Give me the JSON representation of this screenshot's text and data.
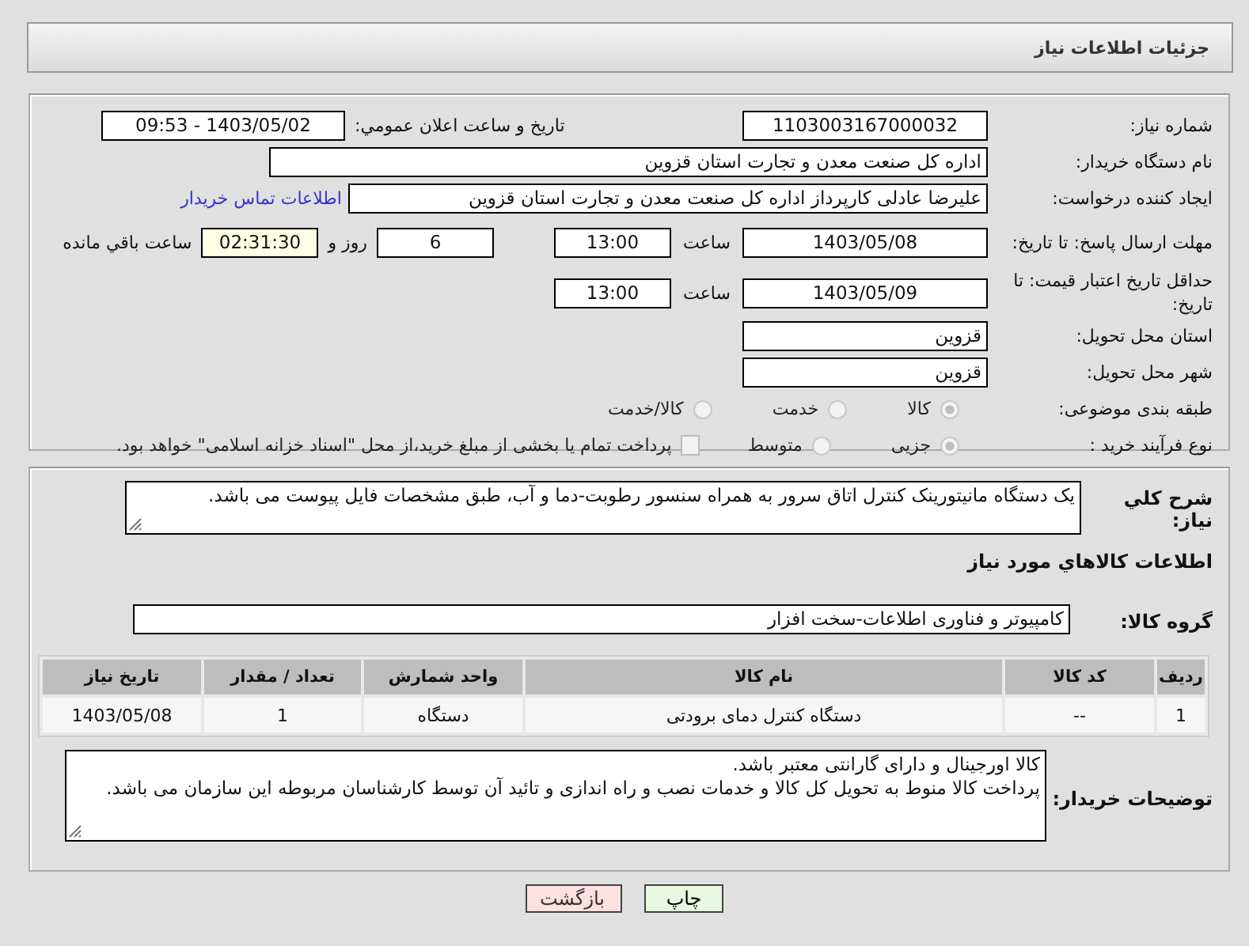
{
  "header": {
    "title": "جزئیات اطلاعات نیاز"
  },
  "need_number": {
    "label": "شماره نیاز:",
    "value": "1103003167000032"
  },
  "announce": {
    "label": "تاریخ و ساعت اعلان عمومي:",
    "value": "1403/05/02 - 09:53"
  },
  "buyer": {
    "label": "نام دستگاه خریدار:",
    "value": "اداره کل صنعت  معدن و تجارت استان قزوین"
  },
  "creator": {
    "label": "ایجاد کننده درخواست:",
    "value": "علیرضا  عادلی کارپرداز اداره کل صنعت  معدن و تجارت استان قزوین",
    "link": "اطلاعات تماس خریدار"
  },
  "deadline": {
    "label": "مهلت ارسال پاسخ: تا تاریخ:",
    "date": "1403/05/08",
    "time_label": "ساعت",
    "time": "13:00",
    "days": "6",
    "days_label": "روز و",
    "remaining": "02:31:30",
    "remaining_label": "ساعت باقي مانده"
  },
  "validity": {
    "label": "حداقل تاریخ اعتبار قیمت: تا تاریخ:",
    "date": "1403/05/09",
    "time_label": "ساعت",
    "time": "13:00"
  },
  "province": {
    "label": "استان محل تحویل:",
    "value": "قزوین"
  },
  "city": {
    "label": "شهر محل تحویل:",
    "value": "قزوین"
  },
  "category": {
    "label": "طبقه بندی موضوعی:",
    "options": [
      {
        "label": "کالا",
        "selected": true
      },
      {
        "label": "خدمت",
        "selected": false
      },
      {
        "label": "کالا/خدمت",
        "selected": false
      }
    ]
  },
  "process": {
    "label": "نوع فرآیند خرید :",
    "options": [
      {
        "label": "جزیی",
        "selected": true
      },
      {
        "label": "متوسط",
        "selected": false
      }
    ],
    "treasury": {
      "checked": false,
      "label": "پرداخت تمام یا بخشی از مبلغ خرید،از محل \"اسناد خزانه اسلامی\" خواهد بود."
    }
  },
  "summary": {
    "label": "شرح کلي نیاز:",
    "value": "یک دستگاه مانیتورینک کنترل اتاق سرور به همراه سنسور رطوبت-دما و آب، طبق مشخصات فایل پیوست می باشد."
  },
  "goods_heading": "اطلاعات کالاهاي مورد نیاز",
  "goods_group": {
    "label": "گروه کالا:",
    "value": "کامپیوتر و فناوری اطلاعات-سخت افزار"
  },
  "table": {
    "columns": [
      "ردیف",
      "کد کالا",
      "نام کالا",
      "واحد شمارش",
      "تعداد / مقدار",
      "تاریخ نیاز"
    ],
    "rows": [
      [
        "1",
        "--",
        "دستگاه کنترل دمای برودتی",
        "دستگاه",
        "1",
        "1403/05/08"
      ]
    ]
  },
  "buyer_notes": {
    "label": "توضیحات خریدار:",
    "lines": [
      "کالا اورجینال و دارای گارانتی معتبر باشد.",
      "پرداخت کالا منوط به تحویل کل کالا و خدمات نصب و راه اندازی و تائید آن توسط کارشناسان مربوطه این سازمان می باشد."
    ]
  },
  "buttons": [
    {
      "label": "چاپ",
      "kind": "print"
    },
    {
      "label": "بازگشت",
      "kind": "back"
    }
  ]
}
